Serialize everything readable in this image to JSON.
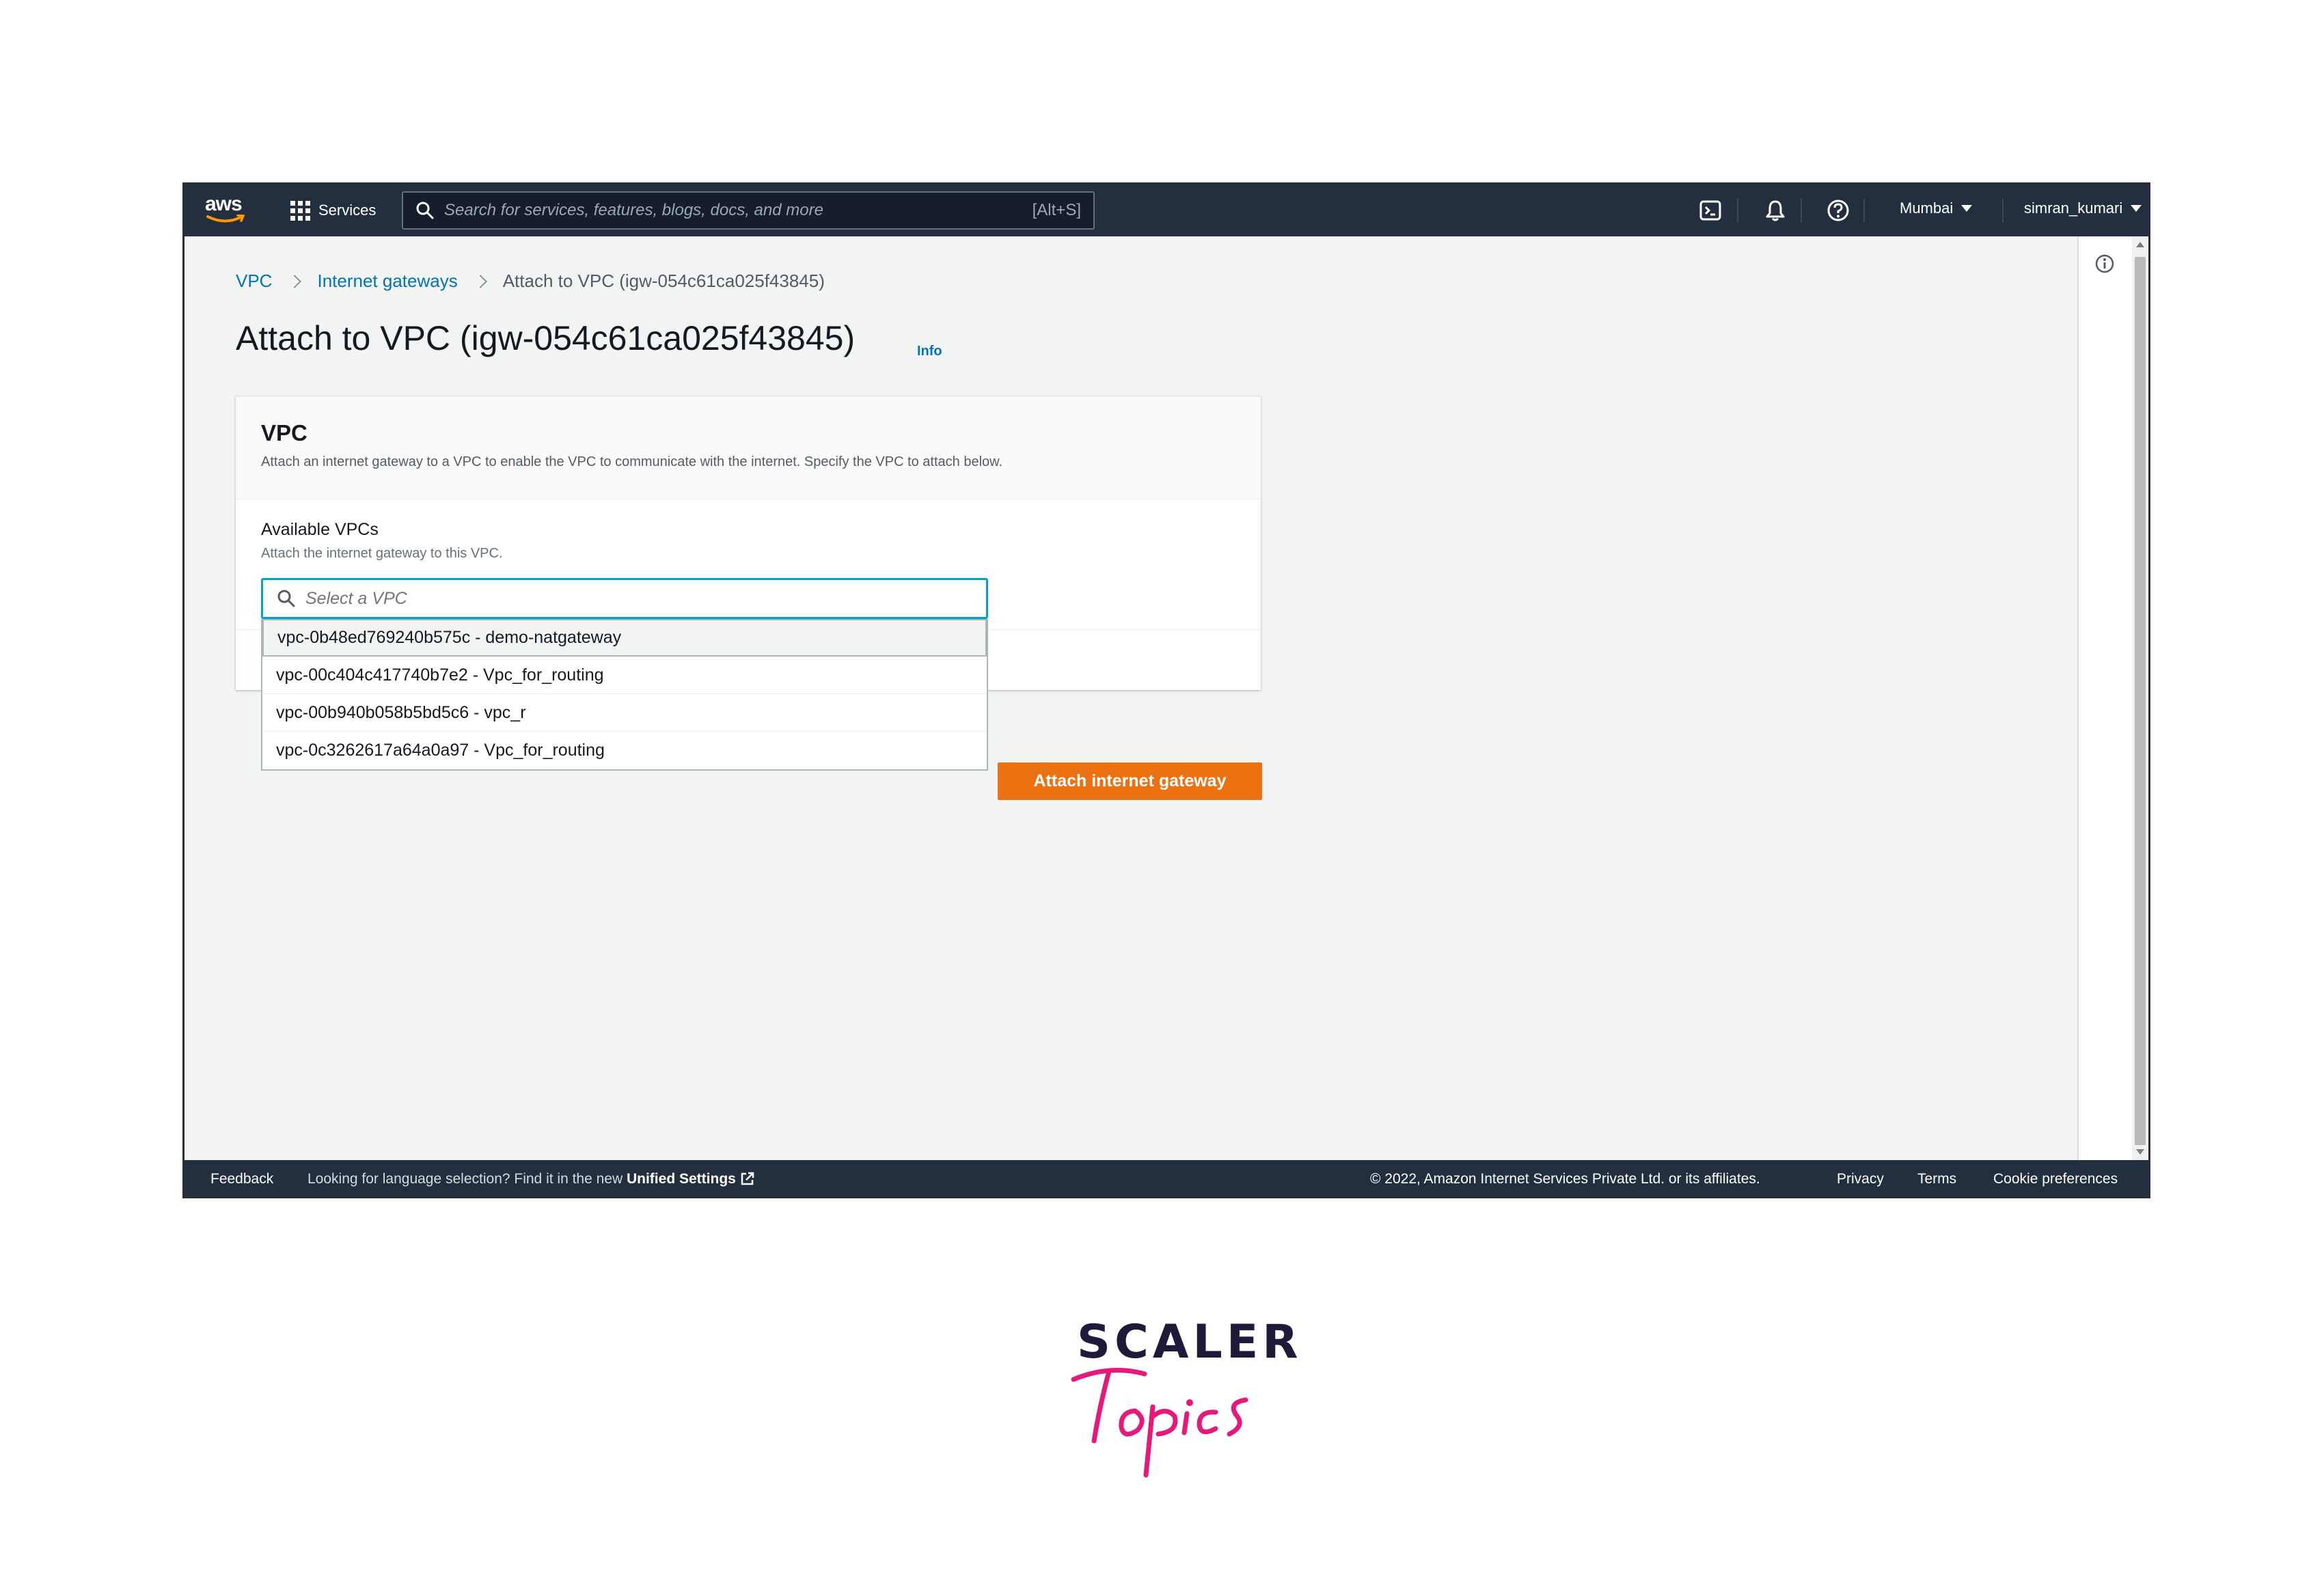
{
  "topnav": {
    "logo_text": "aws",
    "services_label": "Services",
    "search_placeholder": "Search for services, features, blogs, docs, and more",
    "search_shortcut": "[Alt+S]",
    "region": "Mumbai",
    "user": "simran_kumari"
  },
  "breadcrumb": {
    "items": [
      "VPC",
      "Internet gateways",
      "Attach to VPC (igw-054c61ca025f43845)"
    ]
  },
  "page": {
    "title": "Attach to VPC (igw-054c61ca025f43845)",
    "info_link": "Info"
  },
  "card": {
    "title": "VPC",
    "description": "Attach an internet gateway to a VPC to enable the VPC to communicate with the internet. Specify the VPC to attach below.",
    "field_label": "Available VPCs",
    "field_description": "Attach the internet gateway to this VPC.",
    "select_placeholder": "Select a VPC"
  },
  "vpc_options": [
    "vpc-0b48ed769240b575c - demo-natgateway",
    "vpc-00c404c417740b7e2 - Vpc_for_routing",
    "vpc-00b940b058b5bd5c6 - vpc_r",
    "vpc-0c3262617a64a0a97 - Vpc_for_routing"
  ],
  "actions": {
    "attach_label": "Attach internet gateway"
  },
  "footer": {
    "feedback": "Feedback",
    "lang_message": "Looking for language selection? Find it in the new",
    "unified_settings": "Unified Settings",
    "copyright": "© 2022, Amazon Internet Services Private Ltd. or its affiliates.",
    "privacy": "Privacy",
    "terms": "Terms",
    "cookies": "Cookie preferences"
  },
  "brand": {
    "word": "SCALER",
    "script": "Topics"
  },
  "colors": {
    "nav_bg": "#232f3e",
    "accent_orange": "#ec7211",
    "link_blue": "#0073bb",
    "focus_cyan": "#00a1c9",
    "brand_pink": "#e5197a"
  }
}
